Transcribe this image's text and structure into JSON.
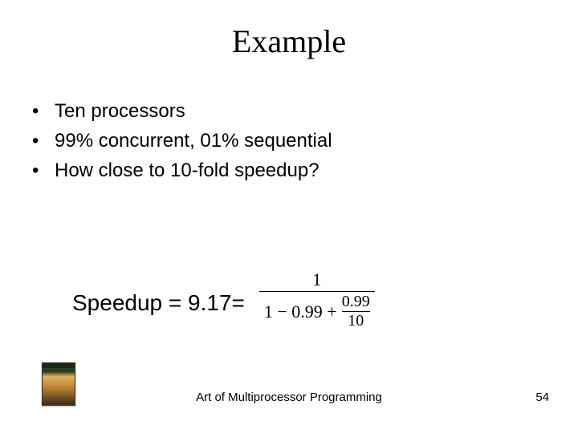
{
  "title": "Example",
  "bullets": [
    "Ten processors",
    "99% concurrent, 01% sequential",
    "How close to 10-fold speedup?"
  ],
  "formula": {
    "lhs": "Speedup = 9.17=",
    "numerator": "1",
    "den_left": "1 − 0.99 +",
    "sub_num": "0.99",
    "sub_den": "10"
  },
  "footer": {
    "text": "Art of Multiprocessor Programming",
    "page": "54"
  }
}
